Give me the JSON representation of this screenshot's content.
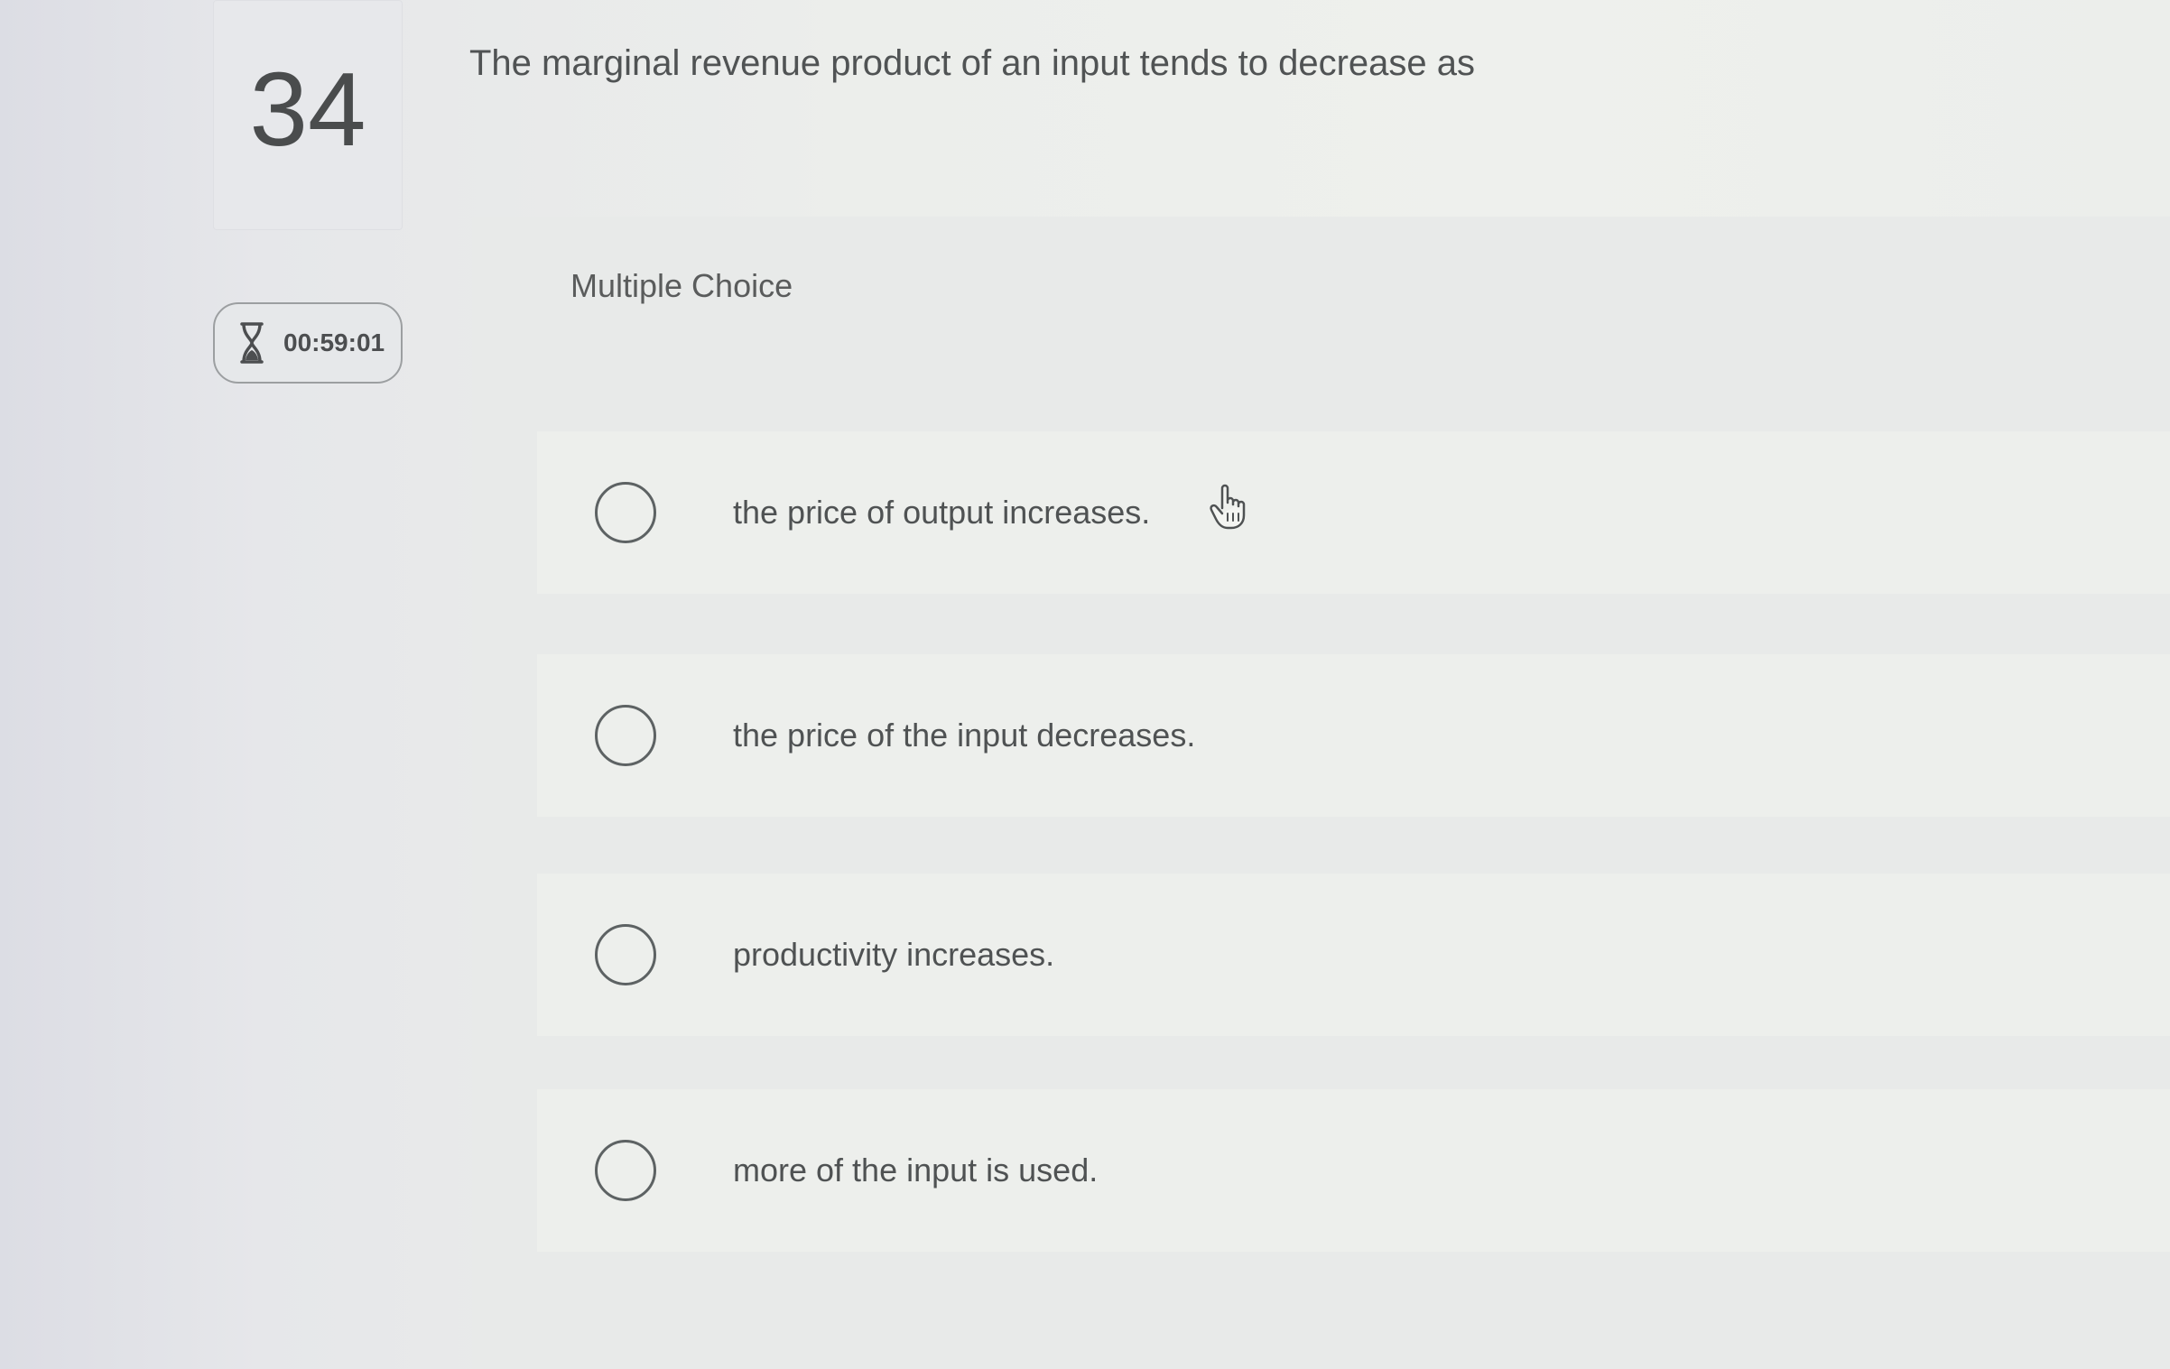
{
  "question": {
    "number": "34",
    "text": "The marginal revenue product of an input tends to decrease as"
  },
  "timer": {
    "icon": "hourglass-icon",
    "value": "00:59:01"
  },
  "answer_panel": {
    "type_label": "Multiple Choice",
    "options": [
      {
        "label": "the price of output increases.",
        "selected": false
      },
      {
        "label": "the price of the input decreases.",
        "selected": false
      },
      {
        "label": "productivity increases.",
        "selected": false
      },
      {
        "label": "more of the input is used.",
        "selected": false
      }
    ]
  },
  "cursor": {
    "icon": "hand-pointer-icon"
  }
}
